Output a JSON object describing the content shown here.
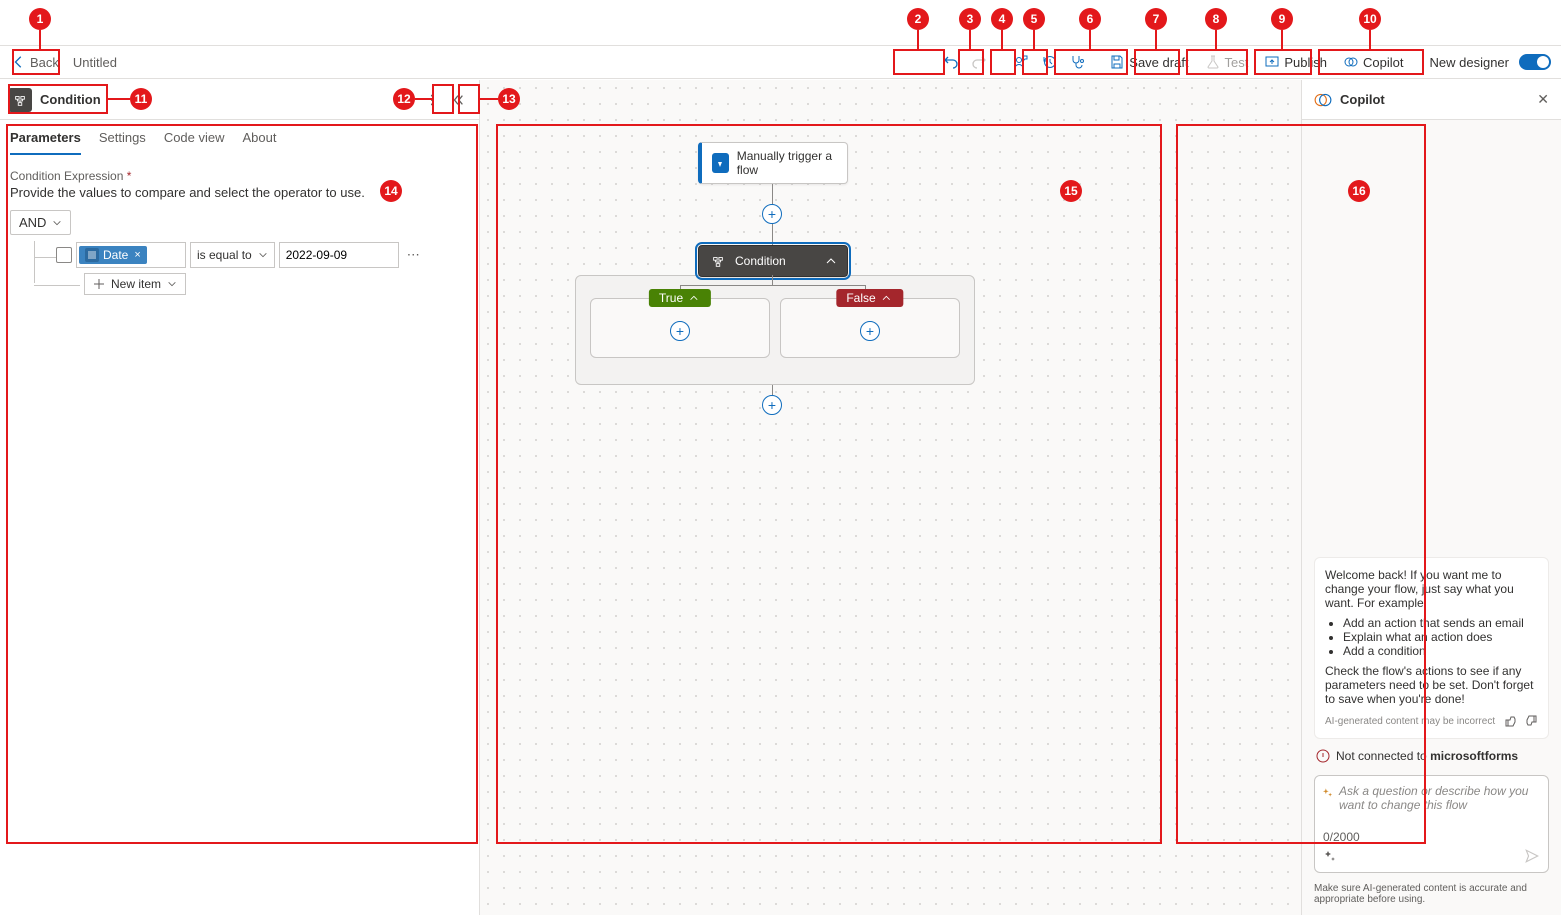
{
  "topbar": {
    "back": "Back",
    "title": "Untitled",
    "save_draft": "Save draft",
    "test": "Test",
    "publish": "Publish",
    "copilot": "Copilot",
    "new_designer": "New designer"
  },
  "left_panel": {
    "title": "Condition",
    "tabs": [
      "Parameters",
      "Settings",
      "Code view",
      "About"
    ],
    "active_tab_index": 0,
    "section_label": "Condition Expression",
    "required_mark": "*",
    "section_help": "Provide the values to compare and select the operator to use.",
    "logic_op": "AND",
    "operand_token": "Date",
    "operator": "is equal to",
    "value": "2022-09-09",
    "new_item": "New item"
  },
  "canvas": {
    "trigger": "Manually trigger a flow",
    "condition": "Condition",
    "true_label": "True",
    "false_label": "False"
  },
  "copilot": {
    "title": "Copilot",
    "welcome": "Welcome back! If you want me to change your flow, just say what you want. For example:",
    "examples": [
      "Add an action that sends an email",
      "Explain what an action does",
      "Add a condition"
    ],
    "tip": "Check the flow's actions to see if any parameters need to be set. Don't forget to save when you're done!",
    "disclaimer": "AI-generated content may be incorrect",
    "not_connected_pre": "Not connected to ",
    "not_connected_bold": "microsoftforms",
    "input_placeholder": "Ask a question or describe how you want to change this flow",
    "counter": "0/2000",
    "footer": "Make sure AI-generated content is accurate and appropriate before using."
  }
}
